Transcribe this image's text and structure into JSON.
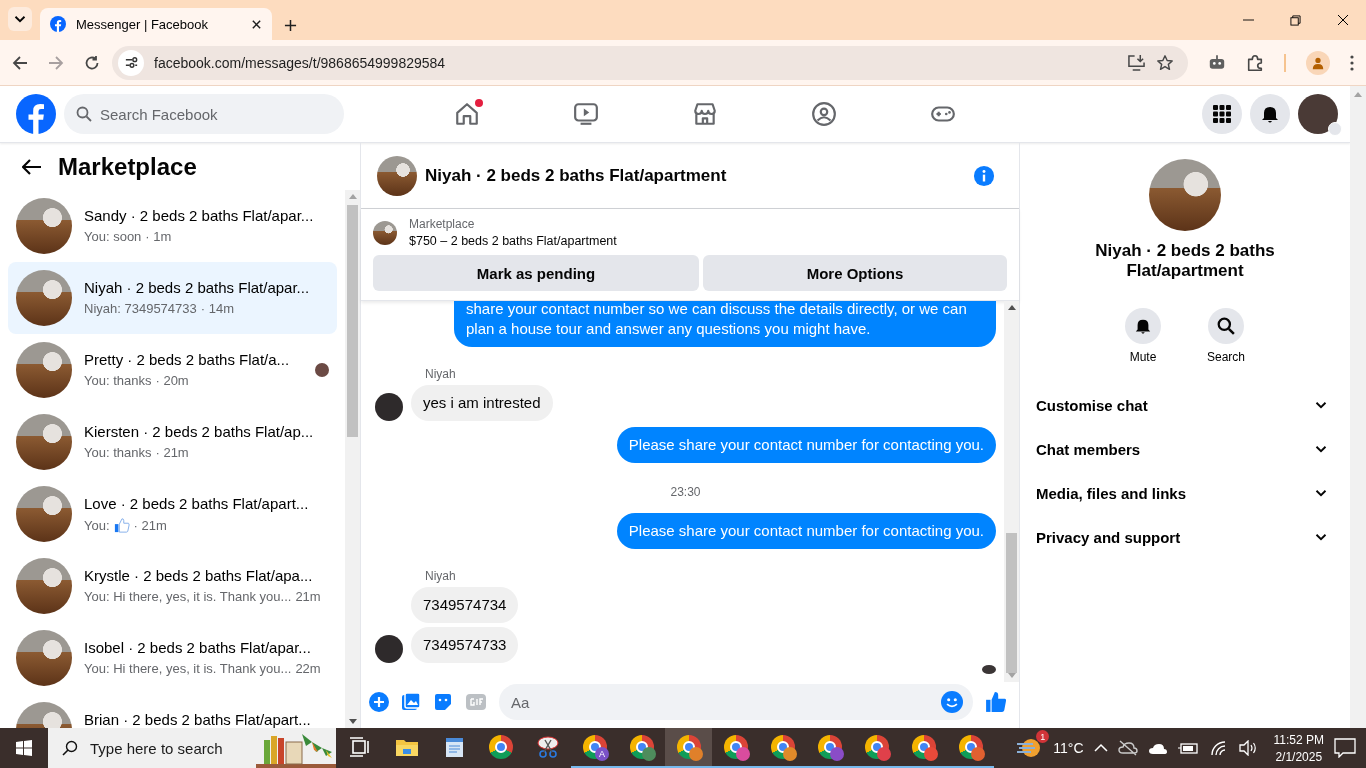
{
  "browser": {
    "tab_title": "Messenger | Facebook",
    "url": "facebook.com/messages/t/9868654999829584",
    "forward_disabled": true
  },
  "topbar": {
    "search_placeholder": "Search Facebook",
    "nav": [
      {
        "kind": "home",
        "badge": true
      },
      {
        "kind": "video",
        "badge": false
      },
      {
        "kind": "marketplace",
        "badge": false
      },
      {
        "kind": "groups",
        "badge": false
      },
      {
        "kind": "gaming",
        "badge": false
      }
    ]
  },
  "sidebar": {
    "title": "Marketplace",
    "conversations": [
      {
        "name": "Sandy · 2 beds 2 baths Flat/apar...",
        "preview": "You: soon",
        "kind": "text",
        "time": "· 1m",
        "selected": false,
        "seen": false
      },
      {
        "name": "Niyah · 2 beds 2 baths Flat/apar...",
        "preview": "Niyah: 7349574733",
        "kind": "text",
        "time": "· 14m",
        "selected": true,
        "seen": false
      },
      {
        "name": "Pretty · 2 beds 2 baths Flat/a...",
        "preview": "You: thanks",
        "kind": "text",
        "time": "· 20m",
        "selected": false,
        "seen": true
      },
      {
        "name": "Kiersten · 2 beds 2 baths Flat/ap...",
        "preview": "You: thanks",
        "kind": "text",
        "time": "· 21m",
        "selected": false,
        "seen": false
      },
      {
        "name": "Love · 2 beds 2 baths Flat/apart...",
        "preview": "You:",
        "kind": "like",
        "time": "· 21m",
        "selected": false,
        "seen": false
      },
      {
        "name": "Krystle · 2 beds 2 baths Flat/apa...",
        "preview": "You: Hi there, yes, it is. Thank you...",
        "kind": "text",
        "time": "21m",
        "selected": false,
        "seen": false
      },
      {
        "name": "Isobel · 2 beds 2 baths Flat/apar...",
        "preview": "You: Hi there, yes, it is. Thank you...",
        "kind": "text",
        "time": "22m",
        "selected": false,
        "seen": false
      },
      {
        "name": "Brian · 2 beds 2 baths Flat/apart...",
        "selected": false,
        "seen": false
      }
    ]
  },
  "chat": {
    "title": "Niyah · 2 beds 2 baths Flat/apartment",
    "listing": {
      "label": "Marketplace",
      "title": "$750 – 2 beds 2 baths Flat/apartment",
      "buttons": [
        "Mark as pending",
        "More Options"
      ]
    },
    "messages": [
      {
        "kind": "outgoing",
        "text": "share your contact number so we can discuss the details directly, or we can plan a house tour and answer any questions you might have."
      },
      {
        "kind": "sender",
        "text": "Niyah"
      },
      {
        "kind": "incoming",
        "text": "yes i am intrested",
        "avatar": true
      },
      {
        "kind": "outgoing",
        "text": "Please share your contact number for contacting you."
      },
      {
        "kind": "timestamp",
        "text": "23:30"
      },
      {
        "kind": "outgoing",
        "text": "Please share your contact number for contacting you."
      },
      {
        "kind": "sender",
        "text": "Niyah"
      },
      {
        "kind": "incoming",
        "text": "7349574734",
        "avatar": false
      },
      {
        "kind": "incoming",
        "text": "7349574733",
        "avatar": true
      }
    ],
    "seen": true,
    "composer_placeholder": "Aa"
  },
  "details": {
    "title": "Niyah · 2 beds 2 baths Flat/apartment",
    "actions": [
      {
        "kind": "mute",
        "label": "Mute"
      },
      {
        "kind": "search",
        "label": "Search"
      }
    ],
    "sections": [
      {
        "label": "Customise chat",
        "expanded": false
      },
      {
        "label": "Chat members",
        "expanded": false
      },
      {
        "label": "Media, files and links",
        "expanded": false
      },
      {
        "label": "Privacy and support",
        "expanded": false
      }
    ]
  },
  "taskbar": {
    "search_placeholder": "Type here to search",
    "apps": [
      {
        "kind": "taskview",
        "running": false,
        "active": false
      },
      {
        "kind": "folder",
        "running": false,
        "active": false
      },
      {
        "kind": "notes",
        "running": false,
        "active": false
      },
      {
        "kind": "chrome",
        "running": false,
        "active": false
      },
      {
        "kind": "snip",
        "running": false,
        "active": false
      },
      {
        "kind": "chrome-profile",
        "running": true,
        "active": false,
        "color": "#7b52c7",
        "badge": "A"
      },
      {
        "kind": "chrome-profile",
        "running": true,
        "active": false,
        "color": "#4e8c5c"
      },
      {
        "kind": "chrome-profile",
        "running": true,
        "active": true,
        "color": "#e0802a"
      },
      {
        "kind": "chrome-profile",
        "running": true,
        "active": false,
        "color": "#d94c9e"
      },
      {
        "kind": "chrome-profile",
        "running": true,
        "active": false,
        "color": "#e08a2a"
      },
      {
        "kind": "chrome-profile",
        "running": true,
        "active": false,
        "color": "#8a4cc7"
      },
      {
        "kind": "chrome-profile",
        "running": true,
        "active": false,
        "color": "#e0404a"
      },
      {
        "kind": "chrome-profile",
        "running": true,
        "active": false,
        "color": "#e84a3a"
      },
      {
        "kind": "chrome-profile",
        "running": true,
        "active": false,
        "color": "#e06030"
      }
    ],
    "weather_badge": "1",
    "temperature": "11°C",
    "time": "11:52 PM",
    "date": "2/1/2025"
  }
}
